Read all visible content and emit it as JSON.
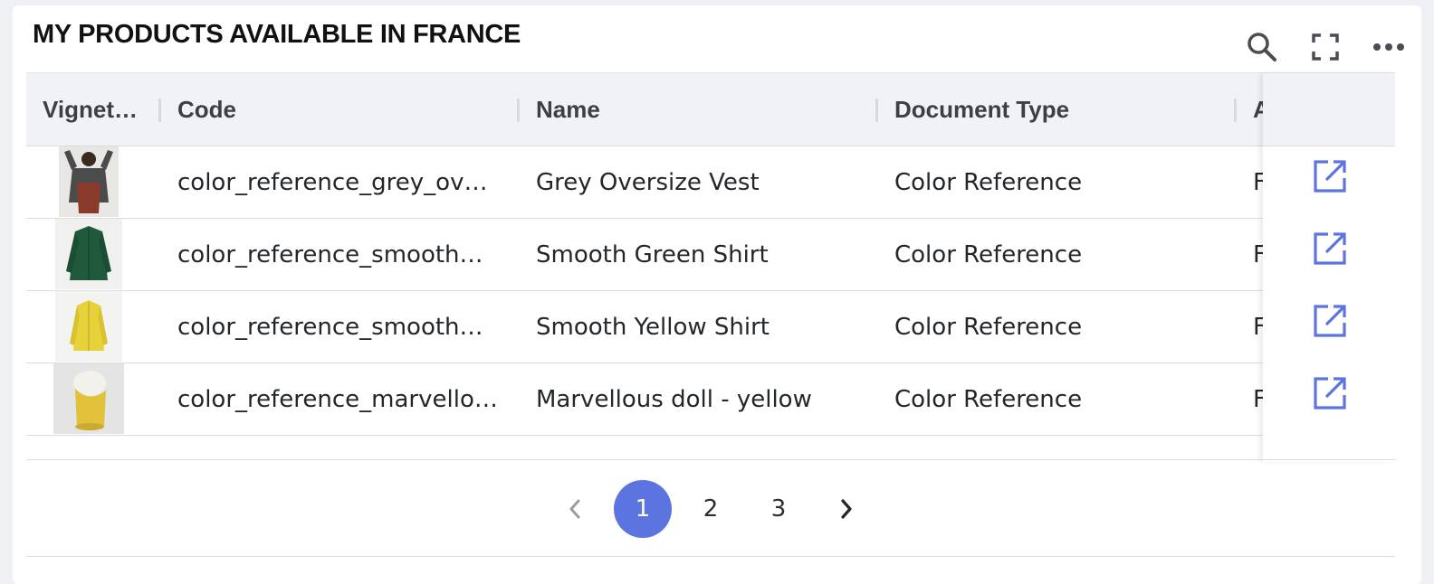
{
  "widget": {
    "title": "MY PRODUCTS AVAILABLE IN FRANCE",
    "toolbar_icons": [
      "search-icon",
      "fullscreen-icon",
      "more-icon"
    ]
  },
  "table": {
    "columns": [
      "Vignet…",
      "Code",
      "Name",
      "Document Type",
      "A"
    ],
    "rows": [
      {
        "thumbnail": "grey-oversize-vest-photo",
        "code": "color_reference_grey_ov…",
        "name": "Grey Oversize Vest",
        "document_type": "Color Reference",
        "extra": "F"
      },
      {
        "thumbnail": "smooth-green-shirt-photo",
        "code": "color_reference_smooth…",
        "name": "Smooth Green Shirt",
        "document_type": "Color Reference",
        "extra": "F"
      },
      {
        "thumbnail": "smooth-yellow-shirt-photo",
        "code": "color_reference_smooth…",
        "name": "Smooth Yellow Shirt",
        "document_type": "Color Reference",
        "extra": "F"
      },
      {
        "thumbnail": "marvellous-doll-photo",
        "code": "color_reference_marvello…",
        "name": "Marvellous doll - yellow",
        "document_type": "Color Reference",
        "extra": "F"
      }
    ],
    "row_action_icon": "open-external-icon"
  },
  "pagination": {
    "prev_icon": "chevron-left-icon",
    "next_icon": "chevron-right-icon",
    "pages": [
      "1",
      "2",
      "3"
    ],
    "current_page": "1"
  },
  "colors": {
    "accent": "#5b74e0",
    "header_bg": "#f1f2f5"
  }
}
